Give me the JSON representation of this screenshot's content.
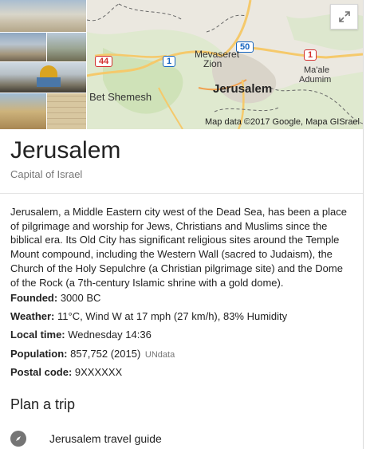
{
  "map": {
    "labels": {
      "mevaseret": "Mevaseret",
      "zion": "Zion",
      "jerusalem": "Jerusalem",
      "beit_shemesh": "Bet Shemesh",
      "maale": "Ma'ale",
      "adumim": "Adumim"
    },
    "roads": {
      "r44": "44",
      "r1a": "1",
      "r50": "50",
      "r1b": "1"
    },
    "attribution": "Map data ©2017 Google, Mapa GISrael"
  },
  "entity": {
    "title": "Jerusalem",
    "subtitle": "Capital of Israel",
    "description": "Jerusalem, a Middle Eastern city west of the Dead Sea, has been a place of pilgrimage and worship for Jews, Christians and Muslims since the biblical era. Its Old City has significant religious sites around the Temple Mount compound, including the Western Wall (sacred to Judaism), the Church of the Holy Sepulchre (a Christian pilgrimage site) and the Dome of the Rock (a 7th-century Islamic shrine with a gold dome)."
  },
  "facts": [
    {
      "label": "Founded:",
      "value": " 3000 BC"
    },
    {
      "label": "Weather:",
      "value": " 11°C, Wind W at 17 mph (27 km/h), 83% Humidity"
    },
    {
      "label": "Local time:",
      "value": " Wednesday 14:36"
    },
    {
      "label": "Population:",
      "value": " 857,752 (2015) ",
      "source": "UNdata"
    },
    {
      "label": "Postal code:",
      "value": " 9XXXXXX"
    }
  ],
  "plan": {
    "heading": "Plan a trip",
    "items": [
      {
        "icon": "compass-icon",
        "label": "Jerusalem travel guide"
      }
    ]
  },
  "colors": {
    "road_red": "#d32f2f",
    "road_blue": "#1565c0"
  }
}
